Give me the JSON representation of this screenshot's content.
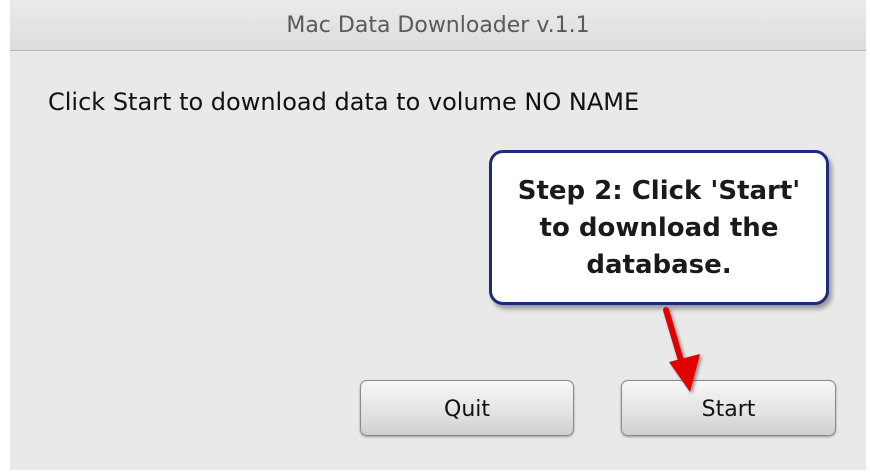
{
  "window": {
    "title": "Mac Data Downloader v.1.1"
  },
  "main": {
    "message": "Click Start to download data to volume NO NAME"
  },
  "callout": {
    "lines": [
      "Step 2: Click 'Start'",
      "to download the",
      "database."
    ],
    "border_color": "#1d2b7a",
    "arrow_color": "#e00000"
  },
  "buttons": {
    "quit_label": "Quit",
    "start_label": "Start"
  }
}
